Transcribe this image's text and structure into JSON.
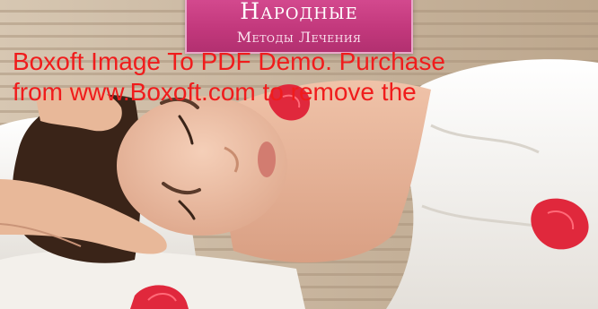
{
  "cover": {
    "title": "Народные",
    "subtitle": "Методы Лечения"
  },
  "watermark": {
    "line1": "Boxoft Image To PDF Demo. Purchase",
    "line2": "from www.Boxoft.com to remove the"
  },
  "colors": {
    "banner": "#c2387c",
    "watermark": "#f01c1c",
    "towel": "#f4f2ee",
    "skin": "#e6b49a",
    "hair": "#3a2418",
    "petal": "#e0283c"
  }
}
